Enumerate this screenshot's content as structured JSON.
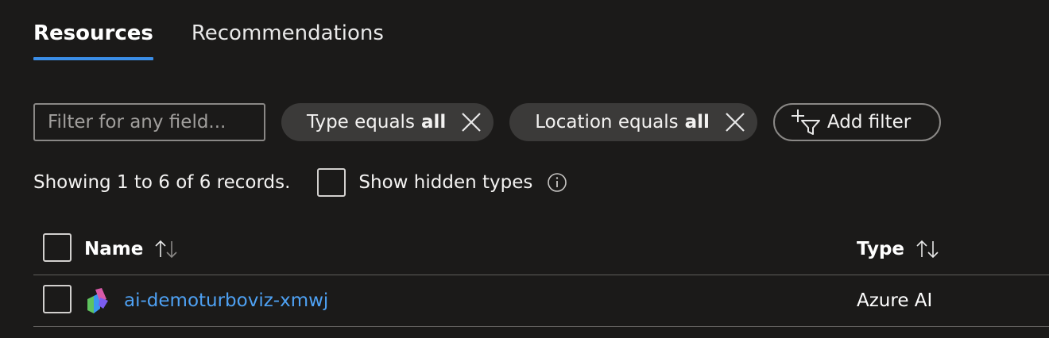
{
  "tabs": [
    {
      "label": "Resources",
      "active": true
    },
    {
      "label": "Recommendations",
      "active": false
    }
  ],
  "filter": {
    "placeholder": "Filter for any field...",
    "value": ""
  },
  "pills": [
    {
      "prefix": "Type equals",
      "value": "all"
    },
    {
      "prefix": "Location equals",
      "value": "all"
    }
  ],
  "add_filter_label": "Add filter",
  "records_text": "Showing 1 to 6 of 6 records.",
  "show_hidden_label": "Show hidden types",
  "table": {
    "columns": [
      {
        "label": "Name"
      },
      {
        "label": "Type"
      }
    ],
    "rows": [
      {
        "name": "ai-demoturboviz-xmwj",
        "type": "Azure AI"
      }
    ]
  },
  "colors": {
    "accent": "#3b8ee8",
    "link": "#4ea1f3",
    "background": "#1b1a19",
    "pill": "#3b3a39"
  },
  "icons": [
    "close-icon",
    "add-filter-icon",
    "info-icon",
    "sort-icon",
    "azure-ai-icon"
  ]
}
